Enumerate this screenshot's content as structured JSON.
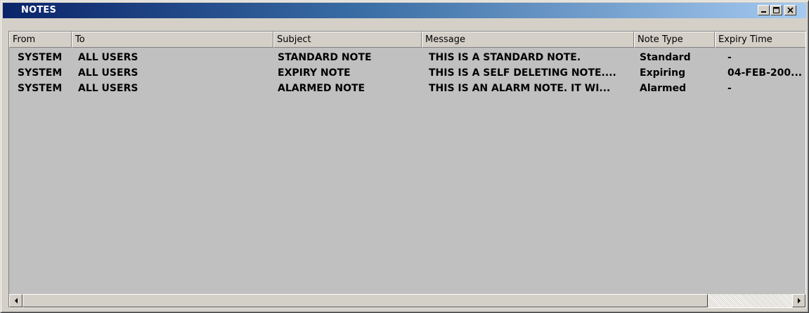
{
  "window": {
    "title": "NOTES"
  },
  "columns": [
    {
      "label": "From"
    },
    {
      "label": "To"
    },
    {
      "label": "Subject"
    },
    {
      "label": "Message"
    },
    {
      "label": "Note Type"
    },
    {
      "label": "Expiry Time"
    }
  ],
  "rows": [
    {
      "from": "SYSTEM",
      "to": "ALL USERS",
      "subject": "STANDARD NOTE",
      "message": "THIS IS A STANDARD NOTE.",
      "note_type": "Standard",
      "expiry": "-"
    },
    {
      "from": "SYSTEM",
      "to": "ALL USERS",
      "subject": "EXPIRY NOTE",
      "message": "THIS IS A SELF DELETING NOTE....",
      "note_type": "Expiring",
      "expiry": "04-FEB-200..."
    },
    {
      "from": "SYSTEM",
      "to": "ALL USERS",
      "subject": "ALARMED NOTE",
      "message": "THIS IS AN ALARM NOTE. IT WI...",
      "note_type": "Alarmed",
      "expiry": "-"
    }
  ],
  "icons": {
    "minimize": "minimize-icon",
    "maximize": "maximize-icon",
    "close": "close-icon",
    "scroll_left": "arrow-left-icon",
    "scroll_right": "arrow-right-icon"
  }
}
